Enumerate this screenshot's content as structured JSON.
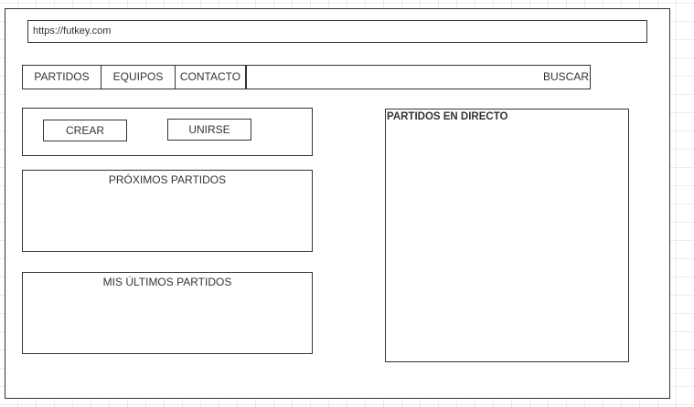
{
  "browser": {
    "url": "https://futkey.com"
  },
  "nav": {
    "items": [
      {
        "label": "PARTIDOS"
      },
      {
        "label": "EQUIPOS"
      },
      {
        "label": "CONTACTO"
      }
    ],
    "search_label": "BUSCAR"
  },
  "actions": {
    "create_label": "CREAR",
    "join_label": "UNIRSE"
  },
  "upcoming": {
    "title": "PRÓXIMOS PARTIDOS"
  },
  "recent": {
    "title": "MIS ÚLTIMOS PARTIDOS"
  },
  "live": {
    "title": "PARTIDOS EN DIRECTO"
  }
}
